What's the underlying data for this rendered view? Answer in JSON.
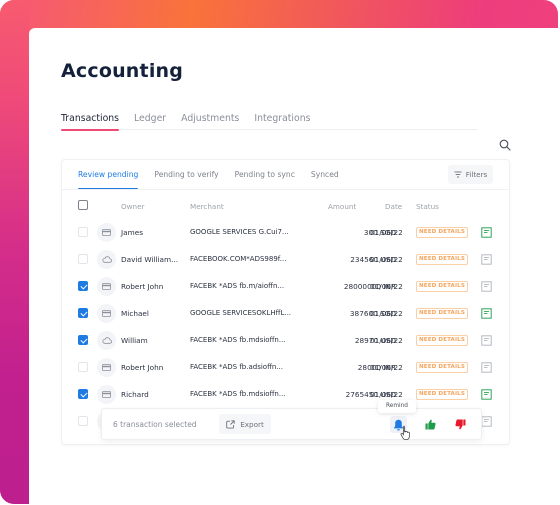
{
  "page": {
    "title": "Accounting"
  },
  "top_tabs": [
    {
      "label": "Transactions",
      "active": true
    },
    {
      "label": "Ledger",
      "active": false
    },
    {
      "label": "Adjustments",
      "active": false
    },
    {
      "label": "Integrations",
      "active": false
    }
  ],
  "search": {
    "icon": "search-icon"
  },
  "sub_tabs": [
    {
      "label": "Review pending",
      "active": true
    },
    {
      "label": "Pending to verify",
      "active": false
    },
    {
      "label": "Pending to sync",
      "active": false
    },
    {
      "label": "Synced",
      "active": false
    }
  ],
  "filters": {
    "label": "Filters",
    "icon": "filter-icon"
  },
  "table": {
    "columns": {
      "owner": "Owner",
      "merchant": "Merchant",
      "amount": "Amount",
      "date": "Date",
      "status": "Status"
    },
    "rows": [
      {
        "checked": false,
        "type": "card",
        "owner": "James",
        "merchant": "GOOGLE SERVICES G.Cui7...",
        "amount": "300 SGD",
        "date": "01/06/22",
        "status": "NEED DETAILS",
        "doc": "green"
      },
      {
        "checked": false,
        "type": "cloud",
        "owner": "David William...",
        "merchant": "FACEBOOK.COM*ADS989f...",
        "amount": "234560 USD",
        "date": "01/06/22",
        "status": "NEED DETAILS",
        "doc": "grey"
      },
      {
        "checked": true,
        "type": "card",
        "owner": "Robert John",
        "merchant": "FACEBK *ADS fb.m/aioffn...",
        "amount": "28000000 INR",
        "date": "01/06/22",
        "status": "NEED DETAILS",
        "doc": "grey"
      },
      {
        "checked": true,
        "type": "card",
        "owner": "Michael",
        "merchant": "GOOGLE SERVICESOKLHffL...",
        "amount": "387600 SGD",
        "date": "01/06/22",
        "status": "NEED DETAILS",
        "doc": "green"
      },
      {
        "checked": true,
        "type": "cloud",
        "owner": "William",
        "merchant": "FACEBK *ADS fb.mdsioffn...",
        "amount": "28970 USD",
        "date": "01/06/22",
        "status": "NEED DETAILS",
        "doc": "grey"
      },
      {
        "checked": false,
        "type": "card",
        "owner": "Robert John",
        "merchant": "FACEBK *ADS fb.adsioffn...",
        "amount": "28000 INR",
        "date": "01/06/22",
        "status": "NEED DETAILS",
        "doc": "grey"
      },
      {
        "checked": true,
        "type": "card",
        "owner": "Richard",
        "merchant": "FACEBK *ADS fb.mdsioffn...",
        "amount": "2765450 USD",
        "date": "01/06/22",
        "status": "NEED DETAILS",
        "doc": "green"
      },
      {
        "checked": false,
        "type": "card",
        "owner": "",
        "merchant": "",
        "amount": "",
        "date": "",
        "status": "",
        "doc": "grey"
      }
    ]
  },
  "action_bar": {
    "selected_text": "6 transaction selected",
    "export_label": "Export",
    "tooltip": "Remind"
  },
  "colors": {
    "accent_blue": "#1f7be3",
    "tab_underline": "#f04a74",
    "badge": "#f4a55e",
    "approve": "#1f9d4a",
    "reject": "#e8192c",
    "doc_green": "#2fa55a",
    "doc_grey": "#b5b9c0"
  }
}
